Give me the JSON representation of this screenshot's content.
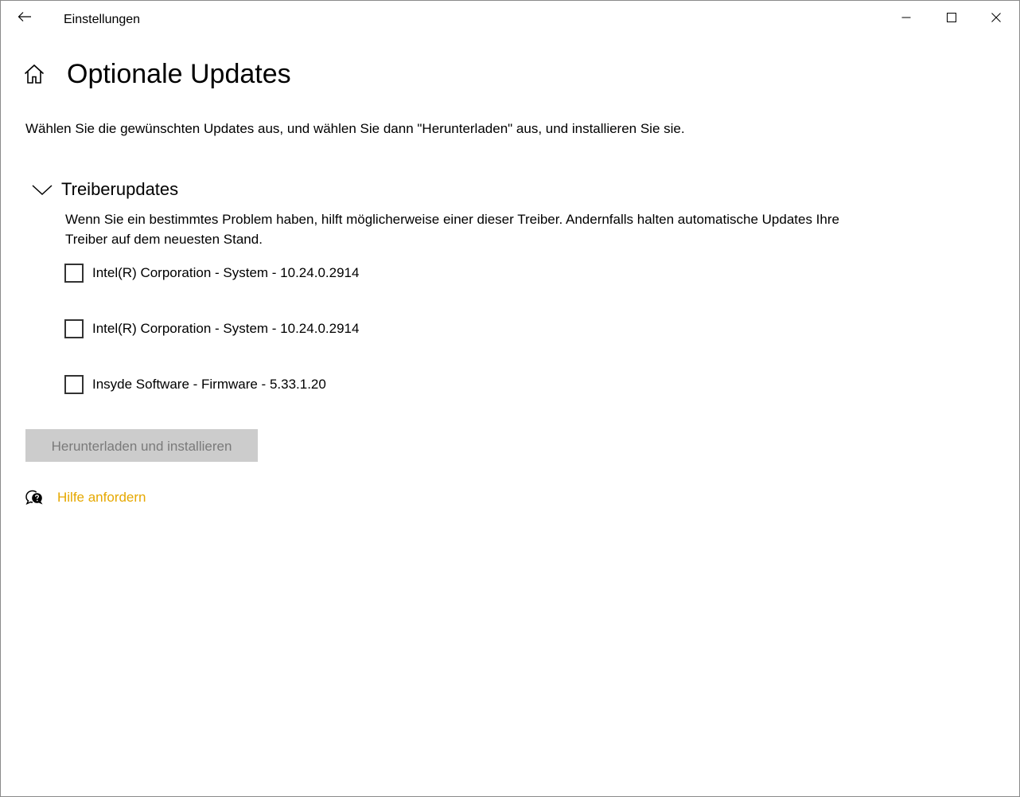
{
  "window": {
    "app_title": "Einstellungen",
    "icons": {
      "back": "back-arrow-icon",
      "minimize": "minimize-icon",
      "maximize": "maximize-icon",
      "close": "close-icon"
    }
  },
  "page": {
    "title": "Optionale Updates",
    "home_icon": "home-icon",
    "intro": "Wählen Sie die gewünschten Updates aus, und wählen Sie dann \"Herunterladen\" aus, und installieren Sie sie."
  },
  "section": {
    "title": "Treiberupdates",
    "expanded": true,
    "chevron_icon": "chevron-down-icon",
    "description": "Wenn Sie ein bestimmtes Problem haben, hilft möglicherweise einer dieser Treiber. Andernfalls halten automatische Updates Ihre Treiber auf dem neuesten Stand.",
    "drivers": [
      {
        "label": "Intel(R) Corporation - System - 10.24.0.2914",
        "checked": false
      },
      {
        "label": "Intel(R) Corporation - System - 10.24.0.2914",
        "checked": false
      },
      {
        "label": "Insyde Software - Firmware - 5.33.1.20",
        "checked": false
      }
    ]
  },
  "actions": {
    "download_label": "Herunterladen und installieren",
    "download_enabled": false
  },
  "help": {
    "icon": "help-chat-icon",
    "label": "Hilfe anfordern"
  },
  "colors": {
    "link": "#e6a800",
    "disabled_button_bg": "#cccccc",
    "disabled_button_text": "#7a7a7a"
  }
}
